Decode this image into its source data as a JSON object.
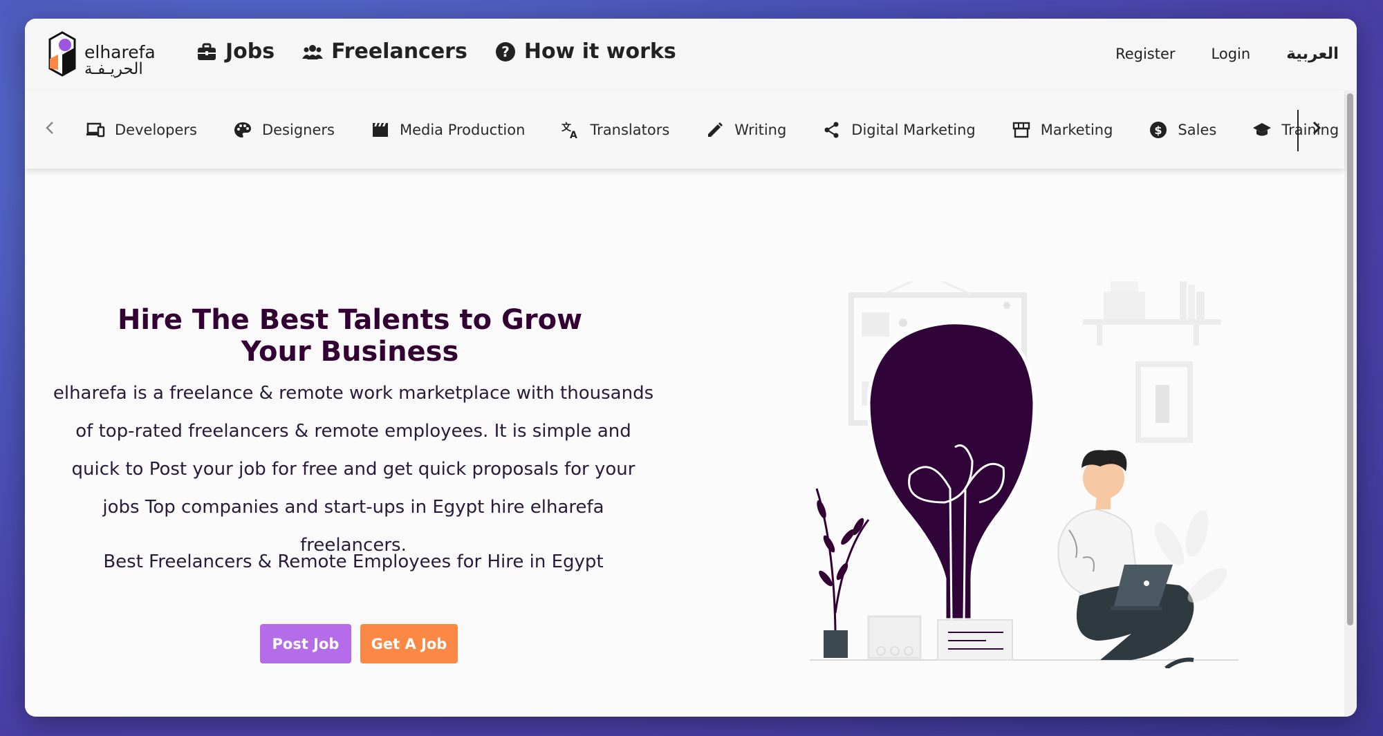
{
  "brand": {
    "name_latin": "elharefa",
    "name_arabic": "الحريـفـة",
    "accent_purple": "#b56ce8",
    "accent_orange": "#fb8844",
    "dark_purple": "#330033"
  },
  "nav": {
    "jobs": "Jobs",
    "freelancers": "Freelancers",
    "how_it_works": "How it works",
    "register": "Register",
    "login": "Login",
    "language": "العربية"
  },
  "categories": [
    {
      "label": "Developers",
      "icon": "devices-icon"
    },
    {
      "label": "Designers",
      "icon": "palette-icon"
    },
    {
      "label": "Media Production",
      "icon": "clapperboard-icon"
    },
    {
      "label": "Translators",
      "icon": "translate-icon"
    },
    {
      "label": "Writing",
      "icon": "pencil-icon"
    },
    {
      "label": "Digital Marketing",
      "icon": "share-icon"
    },
    {
      "label": "Marketing",
      "icon": "storefront-icon"
    },
    {
      "label": "Sales",
      "icon": "dollar-icon"
    },
    {
      "label": "Training",
      "icon": "graduation-cap-icon"
    }
  ],
  "hero": {
    "headline": "Hire The Best Talents to Grow Your Business",
    "description": "elharefa is a freelance & remote work marketplace with thousands of top-rated freelancers & remote employees. It is simple and quick to Post your job for free and get quick proposals for your jobs Top companies and start-ups in Egypt hire elharefa freelancers.",
    "tagline": "Best Freelancers & Remote Employees for Hire in Egypt",
    "post_job": "Post Job",
    "get_job": "Get A Job"
  }
}
